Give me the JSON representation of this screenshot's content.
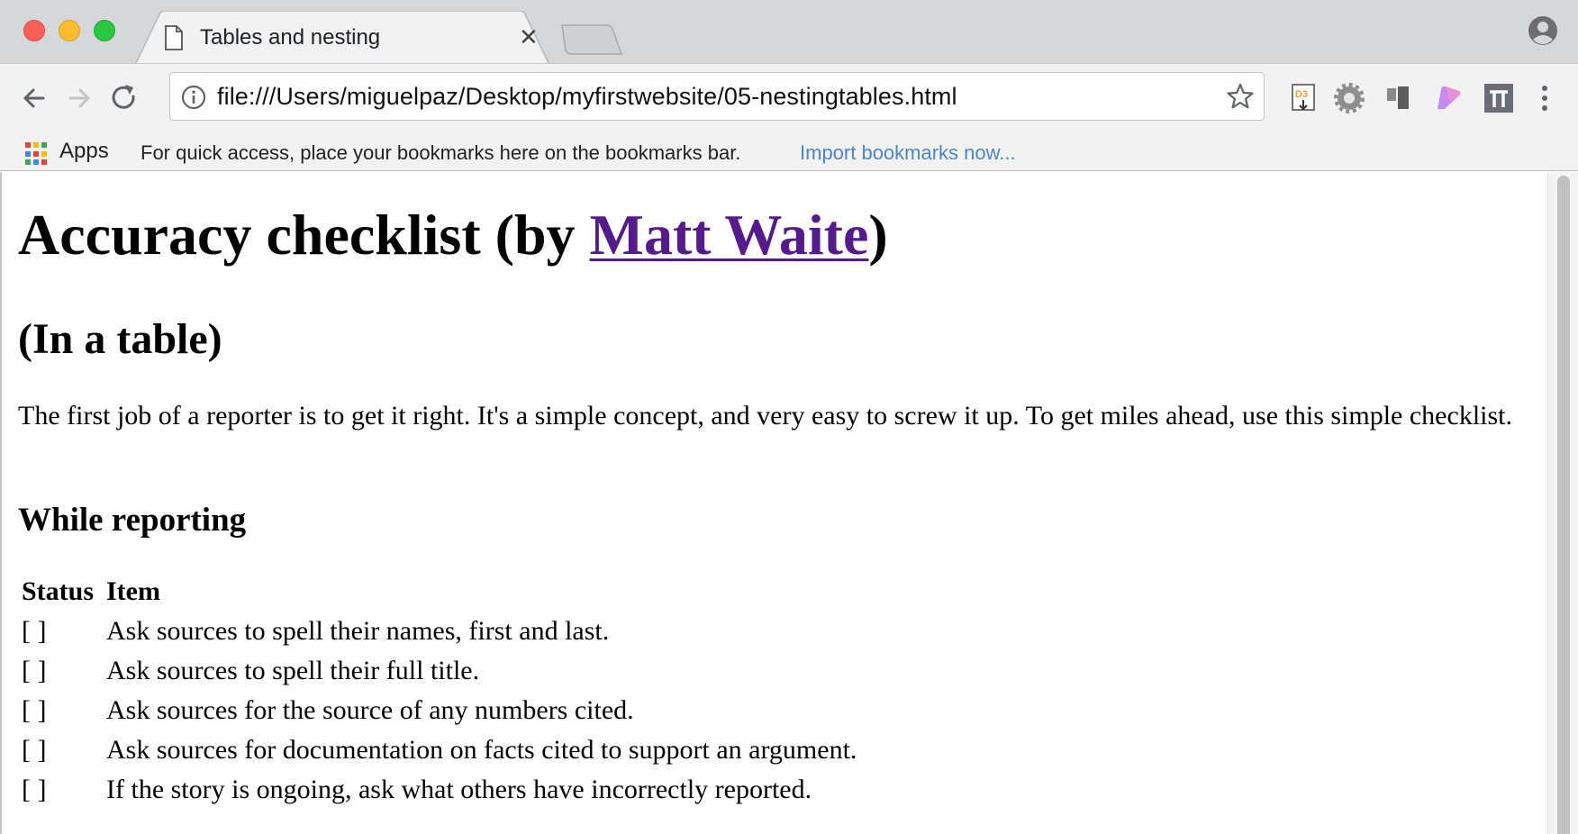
{
  "tab": {
    "title": "Tables and nesting",
    "close_glyph": "✕"
  },
  "omnibox": {
    "url": "file:///Users/miguelpaz/Desktop/myfirstwebsite/05-nestingtables.html"
  },
  "extensions": [
    "d3-extension-icon",
    "gear-extension-icon",
    "panel-extension-icon",
    "paint-extension-icon",
    "pi-extension-icon"
  ],
  "bookmarks": {
    "apps_label": "Apps",
    "hint": "For quick access, place your bookmarks here on the bookmarks bar.",
    "import_link": "Import bookmarks now..."
  },
  "page": {
    "h1_before": "Accuracy checklist (by ",
    "h1_link": "Matt Waite",
    "h1_after": ")",
    "h2": "(In a table)",
    "intro": "The first job of a reporter is to get it right. It's a simple concept, and very easy to screw it up. To get miles ahead, use this simple checklist.",
    "h3": "While reporting",
    "table": {
      "headers": [
        "Status",
        "Item"
      ],
      "rows": [
        {
          "status": "[ ]",
          "item": "Ask sources to spell their names, first and last."
        },
        {
          "status": "[ ]",
          "item": "Ask sources to spell their full title."
        },
        {
          "status": "[ ]",
          "item": "Ask sources for the source of any numbers cited."
        },
        {
          "status": "[ ]",
          "item": "Ask sources for documentation on facts cited to support an argument."
        },
        {
          "status": "[ ]",
          "item": "If the story is ongoing, ask what others have incorrectly reported."
        }
      ]
    }
  },
  "colors": {
    "link_visited": "#551a8b",
    "bookmark_link": "#4a86c7",
    "traffic_red": "#fc5f57",
    "traffic_yellow": "#fdbc2e",
    "traffic_green": "#28c840"
  }
}
